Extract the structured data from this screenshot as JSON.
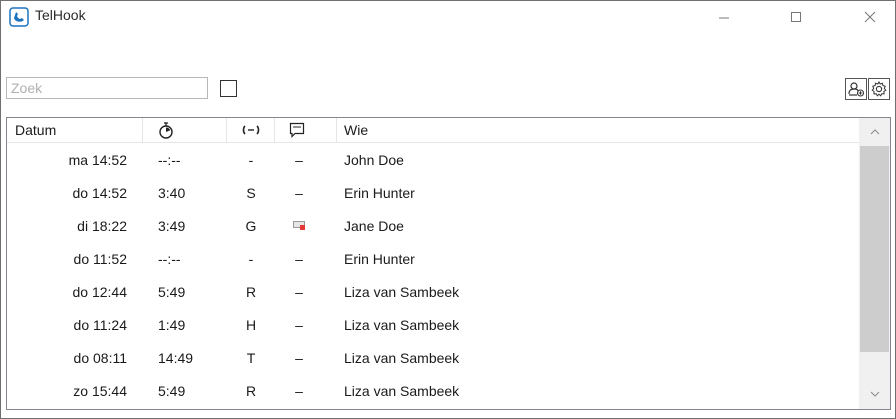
{
  "window": {
    "title": "TelHook"
  },
  "toolbar": {
    "search_placeholder": "Zoek",
    "search_value": ""
  },
  "columns": {
    "datum": "Datum",
    "wie": "Wie"
  },
  "rows": [
    {
      "datum": "ma 14:52",
      "duration": "--:--",
      "calltype": "-",
      "note": "–",
      "note_icon": false,
      "who": "John Doe"
    },
    {
      "datum": "do 14:52",
      "duration": "3:40",
      "calltype": "S",
      "note": "–",
      "note_icon": false,
      "who": "Erin Hunter"
    },
    {
      "datum": "di 18:22",
      "duration": "3:49",
      "calltype": "G",
      "note": "",
      "note_icon": true,
      "who": "Jane Doe"
    },
    {
      "datum": "do 11:52",
      "duration": "--:--",
      "calltype": "-",
      "note": "–",
      "note_icon": false,
      "who": "Erin Hunter"
    },
    {
      "datum": "do 12:44",
      "duration": "5:49",
      "calltype": "R",
      "note": "–",
      "note_icon": false,
      "who": "Liza van Sambeek"
    },
    {
      "datum": "do 11:24",
      "duration": "1:49",
      "calltype": "H",
      "note": "–",
      "note_icon": false,
      "who": "Liza van Sambeek"
    },
    {
      "datum": "do 08:11",
      "duration": "14:49",
      "calltype": "T",
      "note": "–",
      "note_icon": false,
      "who": "Liza van Sambeek"
    },
    {
      "datum": "zo 15:44",
      "duration": "5:49",
      "calltype": "R",
      "note": "–",
      "note_icon": false,
      "who": "Liza van Sambeek"
    }
  ],
  "colors": {
    "accent": "#1e73be",
    "note_badge": "#e53935",
    "scroll_thumb": "#cdcdcd"
  }
}
